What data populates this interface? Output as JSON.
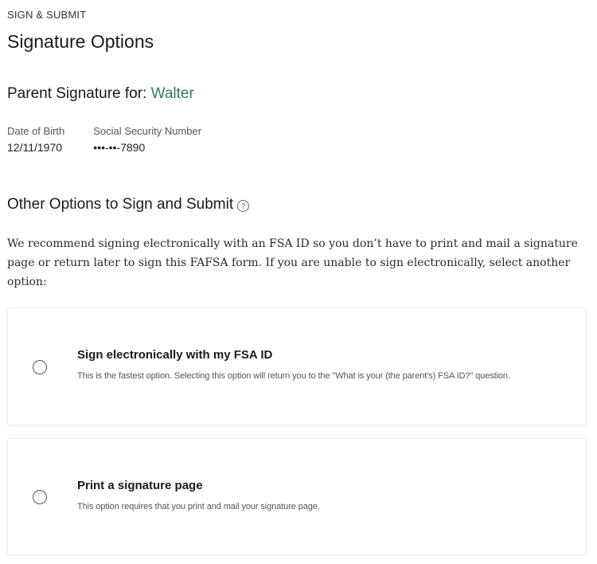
{
  "header": {
    "eyebrow": "SIGN & SUBMIT",
    "title": "Signature Options"
  },
  "parent": {
    "heading_prefix": "Parent Signature for:",
    "name": "Walter",
    "name_color": "#2e7d4f",
    "dob_label": "Date of Birth",
    "dob_value": "12/11/1970",
    "ssn_label": "Social Security Number",
    "ssn_value": "•••-••-7890"
  },
  "other_options": {
    "heading": "Other Options to Sign and Submit",
    "help_icon": "question-circle-icon",
    "help_glyph": "?",
    "intro": "We recommend signing electronically with an FSA ID so you don’t have to print and mail a signature page or return later to sign this FAFSA form. If you are unable to sign electronically, select another option:"
  },
  "options": [
    {
      "title": "Sign electronically with my FSA ID",
      "description": "This is the fastest option. Selecting this option will return you to the \"What is your (the parent's) FSA ID?\" question.",
      "selected": false
    },
    {
      "title": "Print a signature page",
      "description": "This option requires that you print and mail your signature page.",
      "selected": false
    }
  ]
}
